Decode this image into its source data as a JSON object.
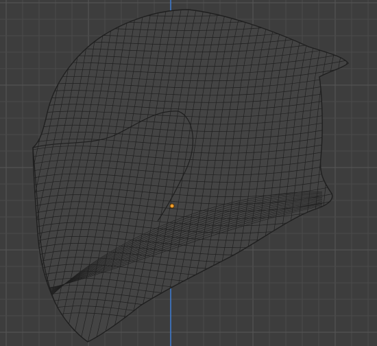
{
  "colors": {
    "background": "#3d3d3d",
    "grid_minor": "#4a4a4a",
    "grid_major": "#575757",
    "axis_z": "#3f7fd6",
    "mesh_fill": "#444444",
    "mesh_wire": "#1f1f1f",
    "origin_fill": "#f0a030",
    "origin_stroke": "#5a3300"
  },
  "icons": {
    "origin": "origin-point-icon"
  }
}
